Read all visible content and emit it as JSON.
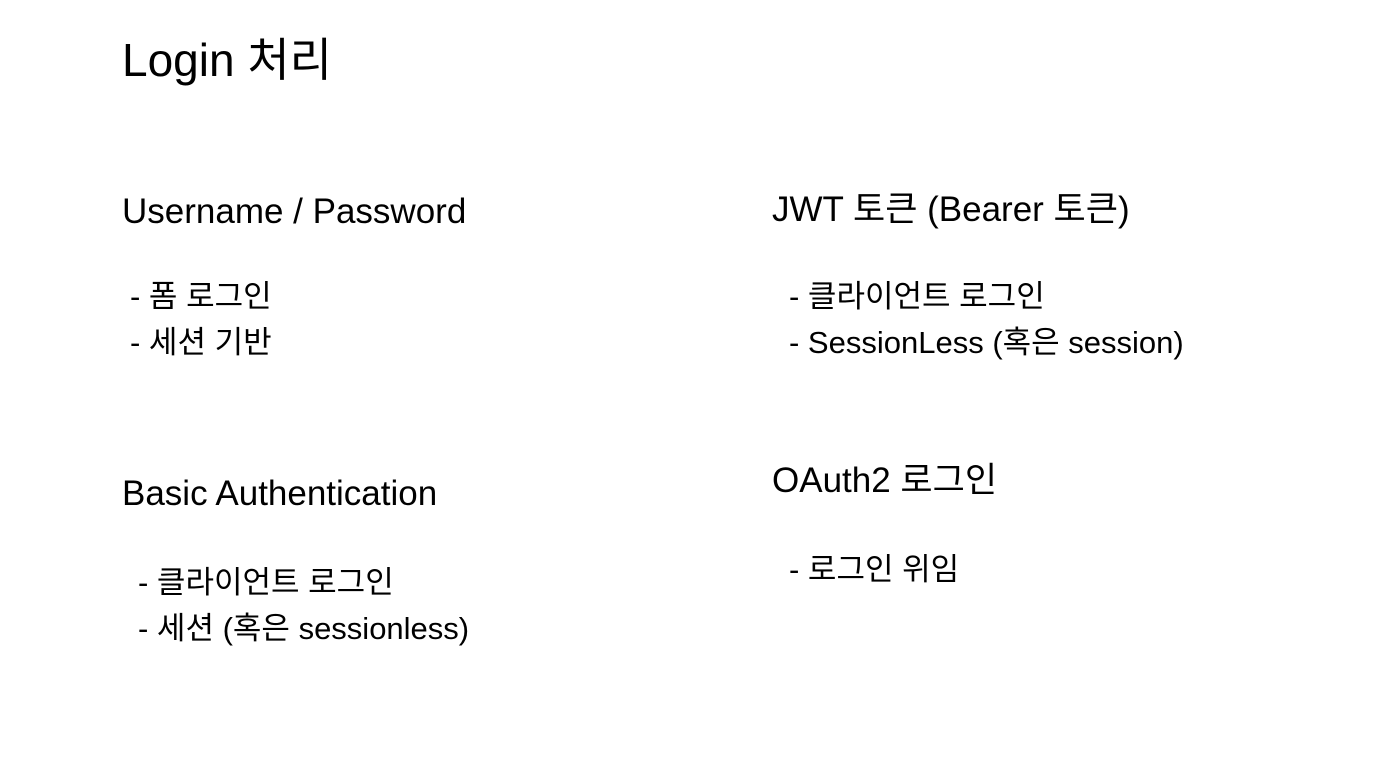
{
  "slide": {
    "title": "Login 처리",
    "sections": [
      {
        "heading": "Username / Password",
        "items": [
          "- 폼 로그인",
          "- 세션 기반"
        ]
      },
      {
        "heading": "Basic Authentication",
        "items": [
          "- 클라이언트 로그인",
          "- 세션 (혹은 sessionless)"
        ]
      },
      {
        "heading": "JWT 토큰 (Bearer 토큰)",
        "items": [
          "- 클라이언트 로그인",
          "- SessionLess (혹은 session)"
        ]
      },
      {
        "heading": "OAuth2 로그인",
        "items": [
          "- 로그인 위임"
        ]
      }
    ]
  }
}
